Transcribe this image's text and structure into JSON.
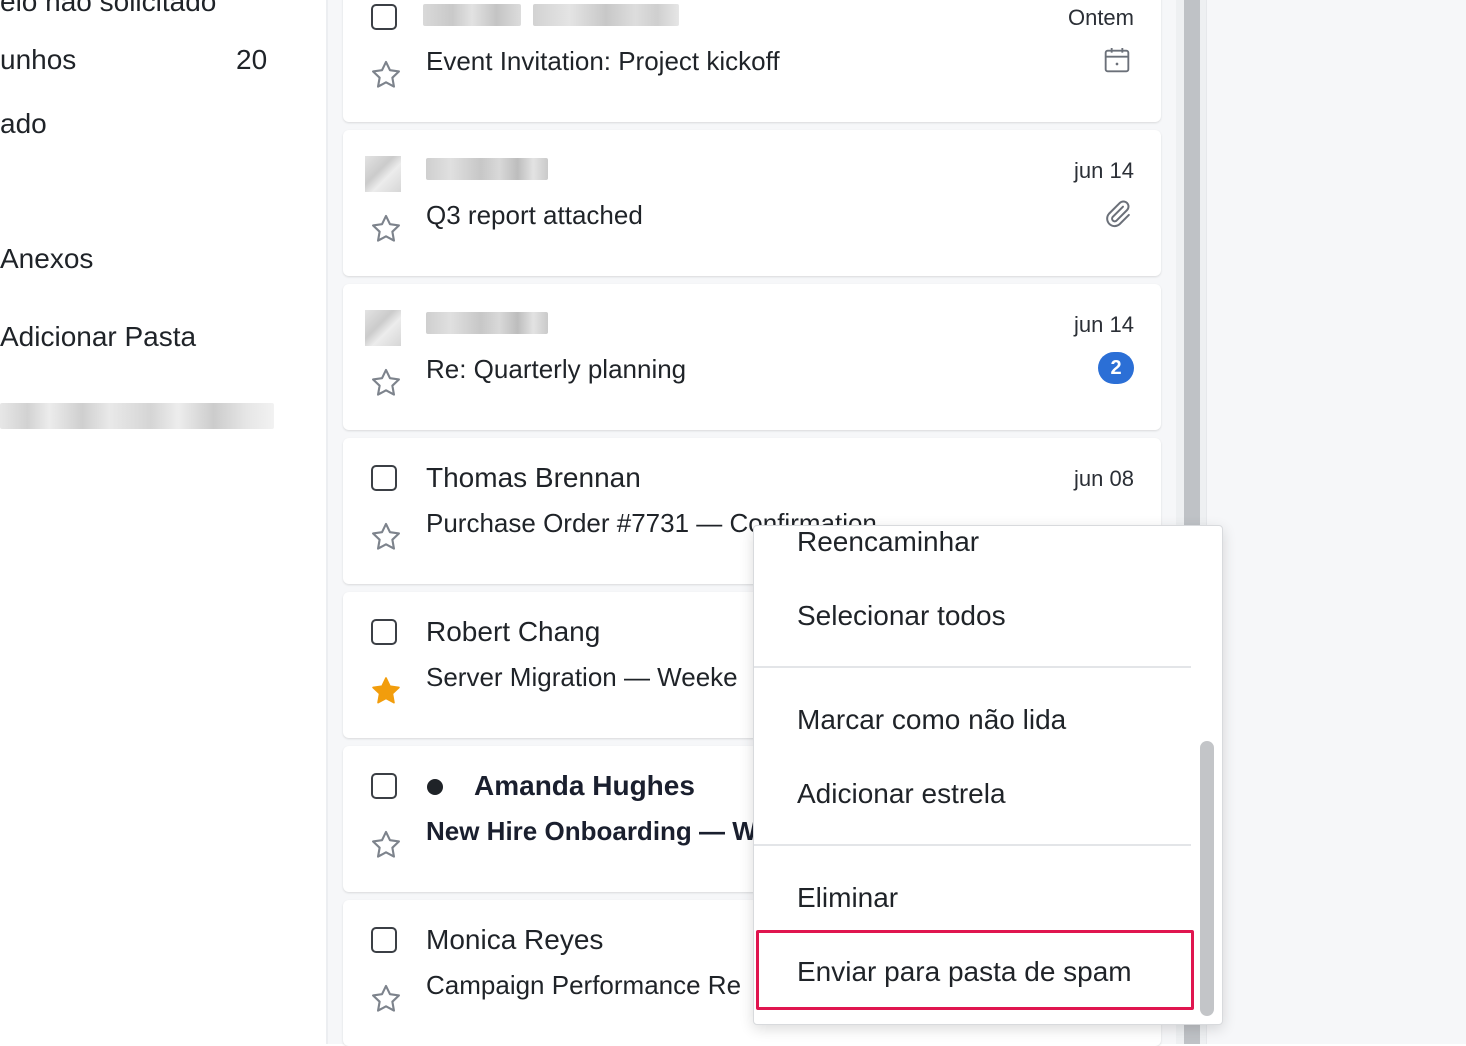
{
  "sidebar": {
    "items": [
      {
        "label": "elo não solicitado"
      },
      {
        "label": "unhos",
        "count": "20"
      },
      {
        "label": "ado"
      },
      {
        "label": "Anexos"
      },
      {
        "label": "Adicionar Pasta"
      }
    ]
  },
  "emails": [
    {
      "sender": "",
      "subject": "Event Invitation: Project kickoff",
      "date": "Ontem",
      "icon": "calendar-icon",
      "starred": false,
      "unread": false
    },
    {
      "sender": "",
      "subject": "Q3 report attached",
      "date": "jun 14",
      "icon": "paperclip-icon",
      "starred": false,
      "unread": false
    },
    {
      "sender": "",
      "subject": "Re: Quarterly planning",
      "date": "jun 14",
      "badge": "2",
      "starred": false,
      "unread": false
    },
    {
      "sender": "Thomas Brennan",
      "subject": "Purchase Order #7731 — Confirmation",
      "date": "jun 08",
      "starred": false,
      "unread": false
    },
    {
      "sender": "Robert Chang",
      "subject": "Server Migration — Weeke",
      "date": "",
      "starred": true,
      "unread": false
    },
    {
      "sender": "Amanda Hughes",
      "subject": "New Hire Onboarding — W",
      "date": "",
      "starred": false,
      "unread": true
    },
    {
      "sender": "Monica Reyes",
      "subject": "Campaign Performance Re",
      "date": "",
      "starred": false,
      "unread": false
    }
  ],
  "context_menu": {
    "items": [
      {
        "label": "Reencaminhar"
      },
      {
        "label": "Selecionar todos"
      },
      {
        "label": "Marcar como não lida"
      },
      {
        "label": "Adicionar estrela"
      },
      {
        "label": "Eliminar"
      },
      {
        "label": "Enviar para pasta de spam"
      }
    ],
    "highlight_color": "#e0154f"
  },
  "colors": {
    "accent_badge": "#2b6fd6",
    "star_filled": "#f29d0c"
  }
}
